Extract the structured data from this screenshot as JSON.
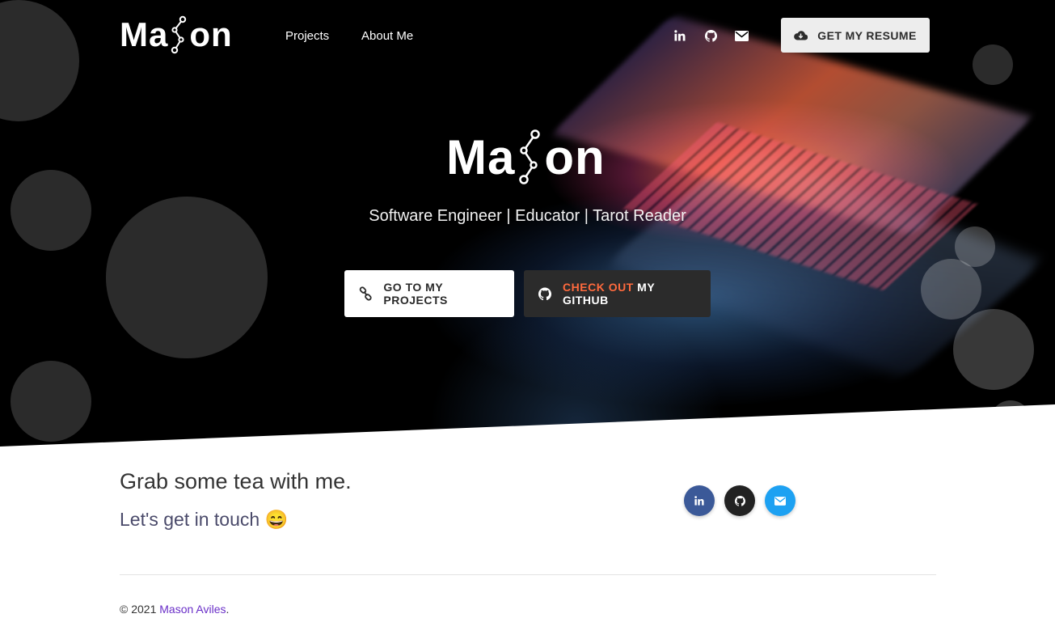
{
  "brand": {
    "logo_prefix": "Ma",
    "logo_suffix": "on"
  },
  "nav": {
    "links": [
      "Projects",
      "About Me"
    ],
    "icons": [
      "linkedin-icon",
      "github-icon",
      "envelope-icon"
    ],
    "resume_button": "GET MY RESUME",
    "resume_icon": "cloud-download-icon"
  },
  "hero": {
    "logo_prefix": "Ma",
    "logo_suffix": "on",
    "tagline": "Software Engineer | Educator | Tarot Reader",
    "projects_button": "GO TO MY PROJECTS",
    "github_button_accent": "CHECK OUT",
    "github_button_rest": "MY GITHUB",
    "accent_color": "#ff6a3d"
  },
  "contact": {
    "heading": "Grab some tea with me.",
    "subheading": "Let's get in touch",
    "emoji": "😄",
    "socials": [
      {
        "icon": "linkedin-icon",
        "color": "#3b5998"
      },
      {
        "icon": "github-icon",
        "color": "#222222"
      },
      {
        "icon": "envelope-icon",
        "color": "#1da1f2"
      }
    ]
  },
  "footer": {
    "copyright": "© 2021",
    "name": "Mason Aviles",
    "period": "."
  }
}
